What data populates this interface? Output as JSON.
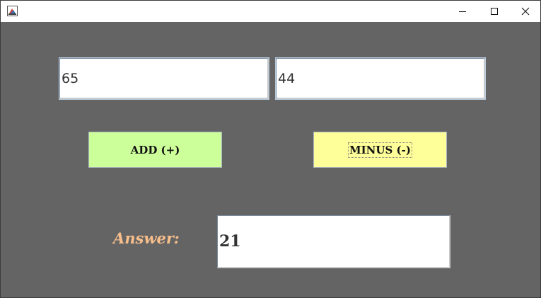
{
  "window": {
    "title": "",
    "controls": {
      "minimize_icon": "minimize-icon",
      "maximize_icon": "maximize-icon",
      "close_icon": "close-icon"
    }
  },
  "inputs": {
    "first_number": "65",
    "second_number": "44"
  },
  "buttons": {
    "add_label": "ADD (+)",
    "minus_label": "MINUS (-)"
  },
  "answer": {
    "label": "Answer:",
    "value": "21"
  },
  "colors": {
    "background": "#646464",
    "add_button": "#ccff99",
    "minus_button": "#ffff99",
    "answer_label": "#f8bf8c"
  }
}
